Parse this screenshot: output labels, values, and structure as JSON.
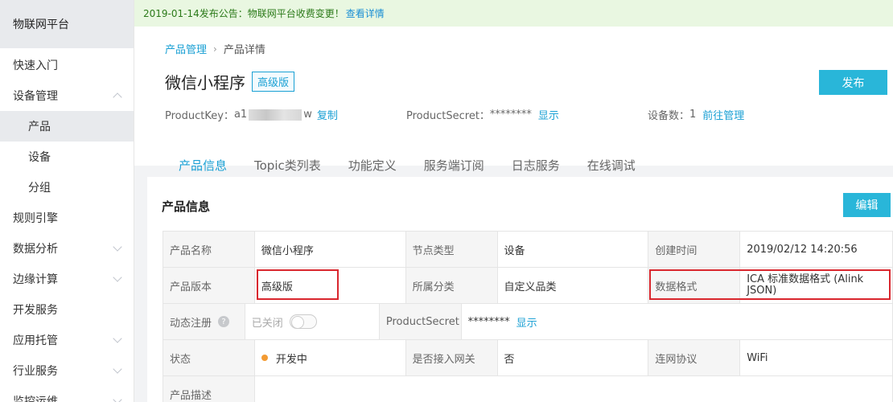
{
  "sidebar": {
    "brand": "物联网平台",
    "items": [
      {
        "label": "快速入门",
        "chevron": ""
      },
      {
        "label": "设备管理",
        "chevron": "up"
      },
      {
        "label": "产品",
        "chevron": "",
        "sub": true,
        "active": true
      },
      {
        "label": "设备",
        "chevron": "",
        "sub": true
      },
      {
        "label": "分组",
        "chevron": "",
        "sub": true
      },
      {
        "label": "规则引擎",
        "chevron": ""
      },
      {
        "label": "数据分析",
        "chevron": "down"
      },
      {
        "label": "边缘计算",
        "chevron": "down"
      },
      {
        "label": "开发服务",
        "chevron": ""
      },
      {
        "label": "应用托管",
        "chevron": "down"
      },
      {
        "label": "行业服务",
        "chevron": "down"
      },
      {
        "label": "监控运维",
        "chevron": "down"
      }
    ]
  },
  "notice": {
    "text": "2019-01-14发布公告：物联网平台收费变更！",
    "link": "查看详情"
  },
  "breadcrumb": {
    "parent": "产品管理",
    "separator": "›",
    "current": "产品详情"
  },
  "product": {
    "title": "微信小程序",
    "tag": "高级版",
    "publish_label": "发布",
    "productkey_label": "ProductKey：",
    "productkey_prefix": "a1",
    "productkey_suffix": "w",
    "copy_label": "复制",
    "secret_label": "ProductSecret：",
    "secret_value": "********",
    "show_label": "显示",
    "devices_label": "设备数：",
    "devices_count": "1",
    "manage_label": "前往管理"
  },
  "tabs": [
    "产品信息",
    "Topic类列表",
    "功能定义",
    "服务端订阅",
    "日志服务",
    "在线调试"
  ],
  "panel": {
    "title": "产品信息",
    "edit_label": "编辑"
  },
  "details": {
    "name_label": "产品名称",
    "name_value": "微信小程序",
    "node_label": "节点类型",
    "node_value": "设备",
    "created_label": "创建时间",
    "created_value": "2019/02/12 14:20:56",
    "edition_label": "产品版本",
    "edition_value": "高级版",
    "category_label": "所属分类",
    "category_value": "自定义品类",
    "format_label": "数据格式",
    "format_value": "ICA 标准数据格式 (Alink JSON)",
    "dynreg_label": "动态注册",
    "dynreg_value": "已关闭",
    "secret_label": "ProductSecret",
    "secret_value": "********",
    "secret_show": "显示",
    "status_label": "状态",
    "status_value": "开发中",
    "gateway_label": "是否接入网关",
    "gateway_value": "否",
    "protocol_label": "连网协议",
    "protocol_value": "WiFi",
    "desc_label": "产品描述"
  },
  "colors": {
    "accent": "#29b6d9",
    "link": "#1aa0d4",
    "highlight": "#d9272e",
    "status_dot": "#f39b33"
  }
}
